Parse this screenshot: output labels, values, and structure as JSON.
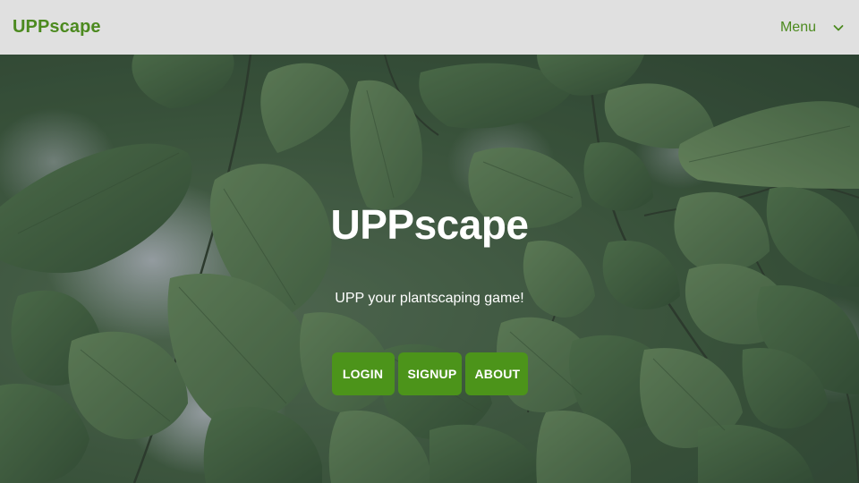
{
  "navbar": {
    "brand": "UPPscape",
    "menu_label": "Menu"
  },
  "hero": {
    "title": "UPPscape",
    "tagline": "UPP your plantscaping game!",
    "buttons": [
      {
        "label": "LOGIN"
      },
      {
        "label": "SIGNUP"
      },
      {
        "label": "ABOUT"
      }
    ]
  },
  "colors": {
    "brand_green": "#4c8a1f",
    "button_green": "#4c941a",
    "navbar_bg": "#e0e0e0"
  },
  "icons": {
    "menu_toggle": "chevron-down-icon",
    "background": "leaves-photo"
  }
}
